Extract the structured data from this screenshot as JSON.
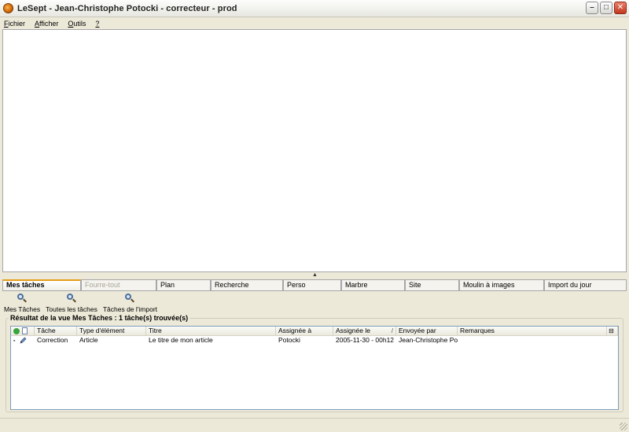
{
  "window": {
    "title": "LeSept - Jean-Christophe Potocki - correcteur - prod"
  },
  "menu": [
    {
      "label": "Fichier",
      "key": "F",
      "rest": "ichier"
    },
    {
      "label": "Afficher",
      "key": "A",
      "rest": "fficher"
    },
    {
      "label": "Outils",
      "key": "O",
      "rest": "utils"
    },
    {
      "label": "?",
      "key": "?",
      "rest": ""
    }
  ],
  "tabs": [
    {
      "label": "Mes tâches",
      "state": "active"
    },
    {
      "label": "Fourre-tout",
      "state": "disabled"
    },
    {
      "label": "Plan",
      "state": "normal"
    },
    {
      "label": "Recherche",
      "state": "normal"
    },
    {
      "label": "Perso",
      "state": "normal"
    },
    {
      "label": "Marbre",
      "state": "normal"
    },
    {
      "label": "Site",
      "state": "normal"
    },
    {
      "label": "Moulin à images",
      "state": "normal"
    },
    {
      "label": "Import du jour",
      "state": "normal"
    }
  ],
  "toolbar": [
    {
      "label": "Mes Tâches",
      "icon": "search-icon"
    },
    {
      "label": "Toutes les tâches",
      "icon": "search-icon"
    },
    {
      "label": "Tâches de l'import",
      "icon": "search-icon"
    }
  ],
  "results": {
    "title": "Résultat de la vue Mes Tâches : 1 tâche(s) trouvée(s)",
    "columns": [
      "Tâche",
      "Type d'élément",
      "Titre",
      "Assignée à",
      "Assignée le",
      "Envoyée par",
      "Remarques"
    ],
    "sort_marker": "/",
    "rows": [
      {
        "tache": "Correction",
        "type": "Article",
        "titre": "Le titre de mon article",
        "assignee_a": "Potocki",
        "assignee_le": "2005-11-30 - 00h12",
        "envoyee_par": "Jean-Christophe Po...",
        "remarques": ""
      }
    ]
  },
  "colors": {
    "active_tab_accent": "#e79c18",
    "window_bg": "#ece9d8",
    "grid_border": "#7f9db9",
    "close_button": "#c1381f"
  }
}
